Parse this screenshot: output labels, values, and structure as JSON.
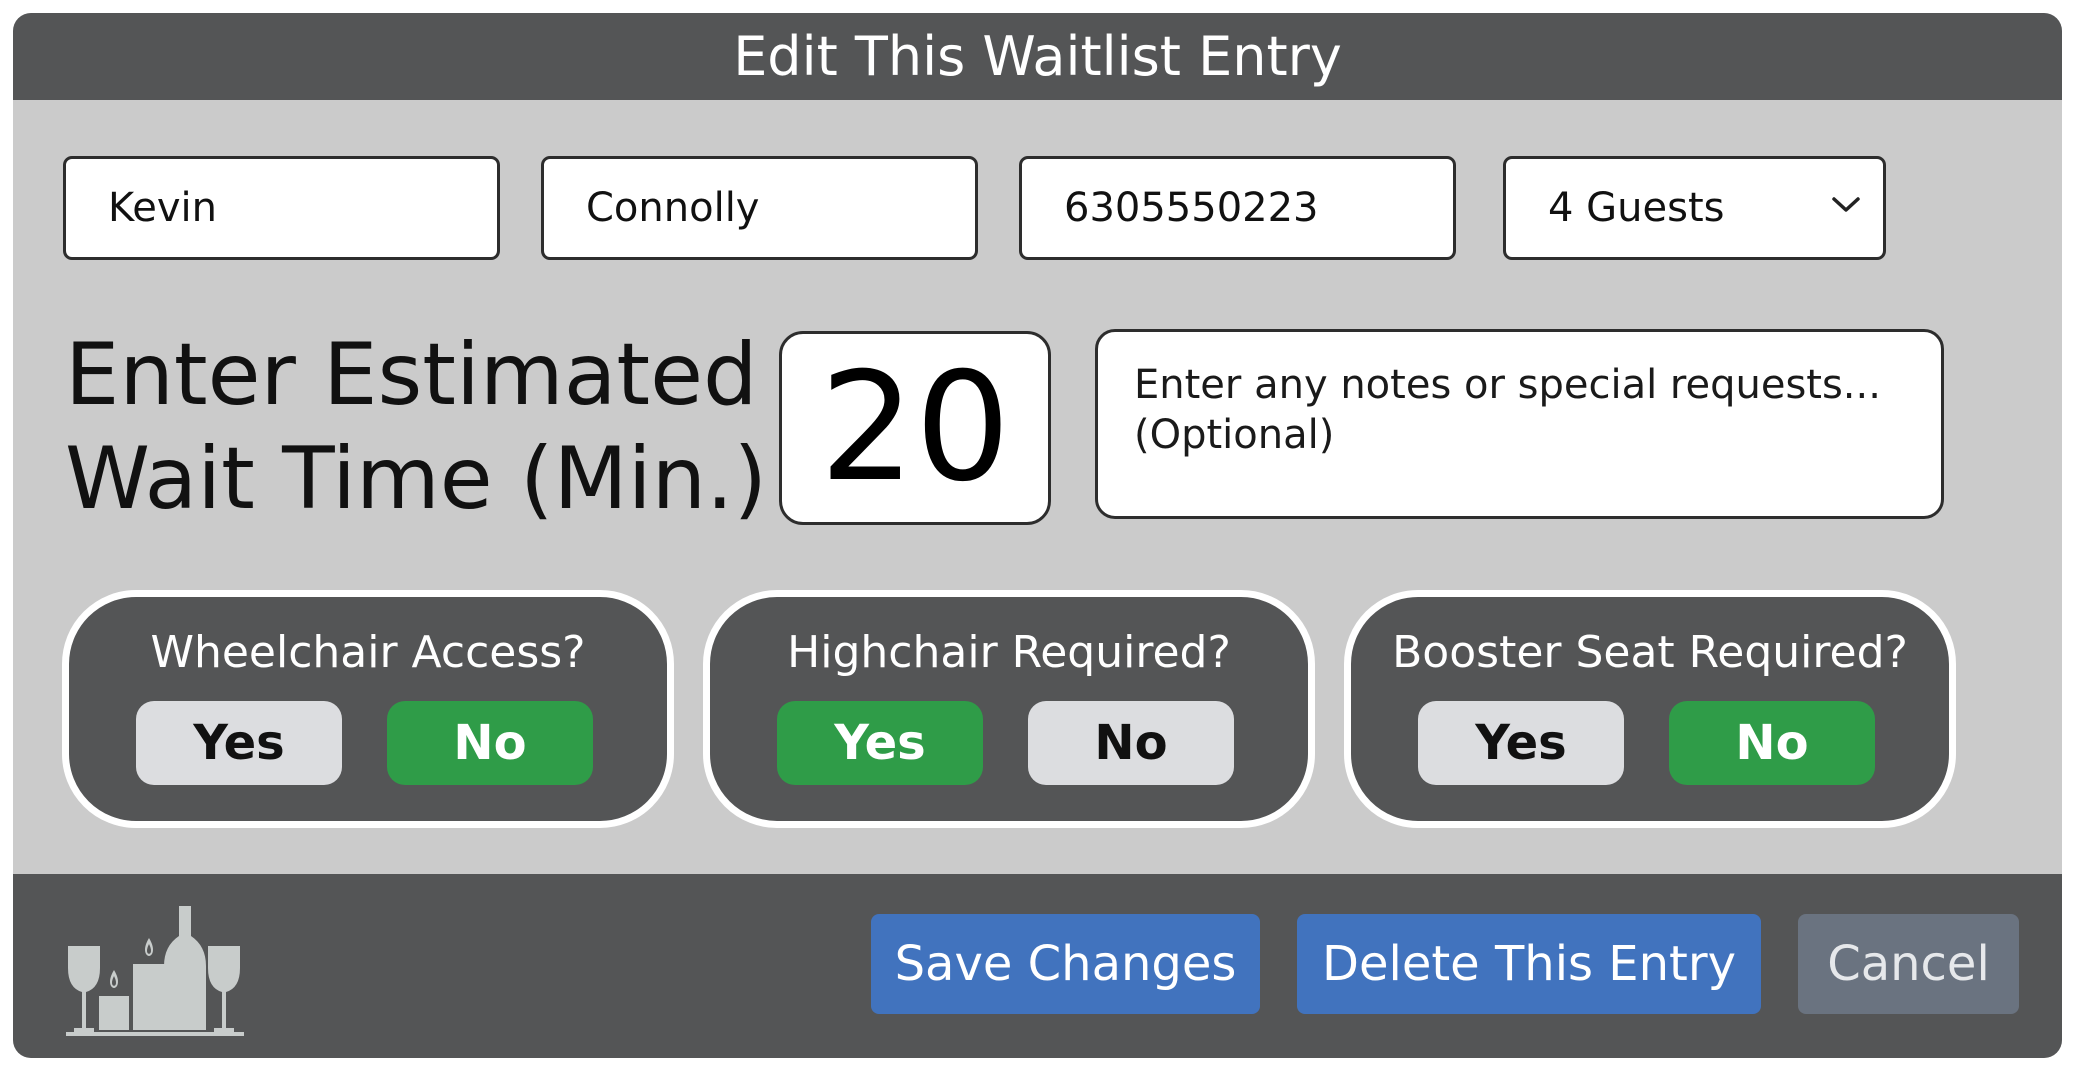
{
  "dialog": {
    "title": "Edit This Waitlist Entry"
  },
  "form": {
    "first_name": "Kevin",
    "last_name": "Connolly",
    "phone": "6305550223",
    "guests": "4 Guests"
  },
  "wait": {
    "label_line1": "Enter Estimated",
    "label_line2": "Wait Time (Min.)",
    "value": "20"
  },
  "notes": {
    "placeholder_line1": "Enter any notes or special requests...",
    "placeholder_line2": "(Optional)"
  },
  "options": [
    {
      "label": "Wheelchair Access?",
      "yes": "Yes",
      "no": "No",
      "selected": "No"
    },
    {
      "label": "Highchair Required?",
      "yes": "Yes",
      "no": "No",
      "selected": "Yes"
    },
    {
      "label": "Booster Seat Required?",
      "yes": "Yes",
      "no": "No",
      "selected": "No"
    }
  ],
  "footer": {
    "save_label": "Save Changes",
    "delete_label": "Delete This Entry",
    "cancel_label": "Cancel",
    "logo_icon": "restaurant-candles-bottle-icon"
  },
  "colors": {
    "header_bg": "#545556",
    "panel_bg": "#cbcbcb",
    "selected_green": "#2f9c48",
    "primary_blue": "#4173be",
    "cancel_gray": "#6a7380"
  }
}
